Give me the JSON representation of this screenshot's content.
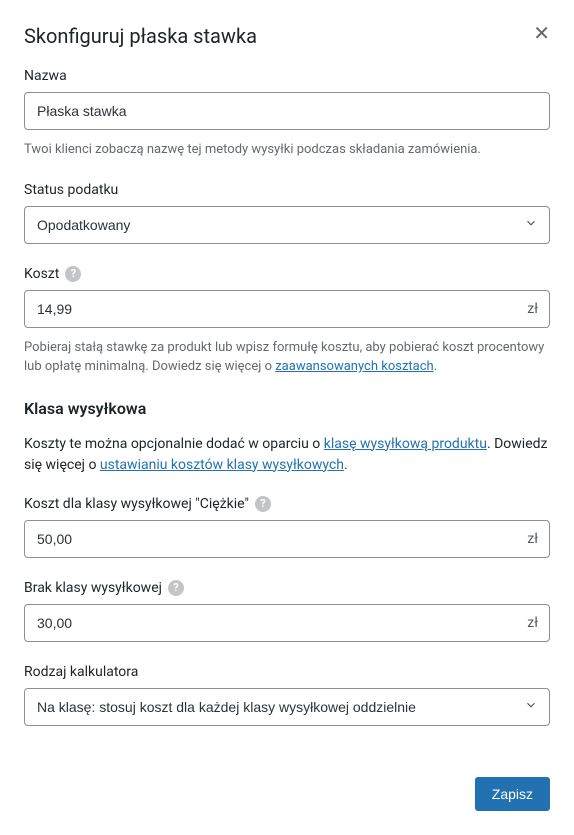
{
  "header": {
    "title": "Skonfiguruj płaska stawka"
  },
  "name": {
    "label": "Nazwa",
    "value": "Płaska stawka",
    "help": "Twoi klienci zobaczą nazwę tej metody wysyłki podczas składania zamówienia."
  },
  "taxStatus": {
    "label": "Status podatku",
    "value": "Opodatkowany"
  },
  "cost": {
    "label": "Koszt",
    "value": "14,99",
    "suffix": "zł",
    "help_pre": "Pobieraj stałą stawkę za produkt lub wpisz formułę kosztu, aby pobierać koszt procentowy lub opłatę minimalną. Dowiedz się więcej o ",
    "help_link": "zaawansowanych kosztach",
    "help_post": "."
  },
  "shippingClass": {
    "header": "Klasa wysyłkowa",
    "intro_pre": "Koszty te można opcjonalnie dodać w oparciu o ",
    "link1": "klasę wysyłkową produktu",
    "intro_mid": ". Dowiedz się więcej o ",
    "link2": "ustawianiu kosztów klasy wysyłkowych",
    "intro_post": "."
  },
  "heavyClass": {
    "label": "Koszt dla klasy wysyłkowej \"Ciężkie\"",
    "value": "50,00",
    "suffix": "zł"
  },
  "noClass": {
    "label": "Brak klasy wysyłkowej",
    "value": "30,00",
    "suffix": "zł"
  },
  "calculator": {
    "label": "Rodzaj kalkulatora",
    "value": "Na klasę: stosuj koszt dla każdej klasy wysyłkowej oddzielnie"
  },
  "footer": {
    "save": "Zapisz"
  }
}
